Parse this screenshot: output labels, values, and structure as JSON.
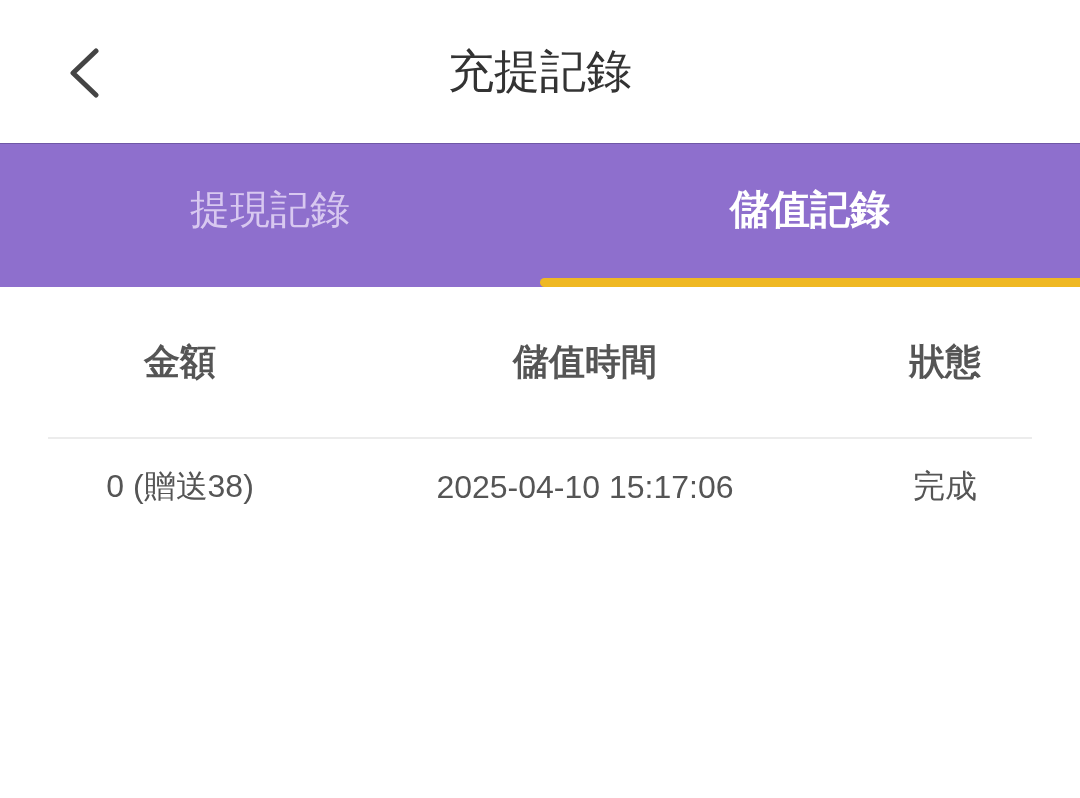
{
  "header": {
    "title": "充提記錄"
  },
  "tabs": [
    {
      "label": "提現記錄",
      "selected": false
    },
    {
      "label": "儲值記錄",
      "selected": true
    }
  ],
  "table": {
    "columns": [
      "金額",
      "儲值時間",
      "狀態"
    ],
    "rows": [
      [
        "0 (贈送38)",
        "2025-04-10 15:17:06",
        "完成"
      ]
    ]
  }
}
